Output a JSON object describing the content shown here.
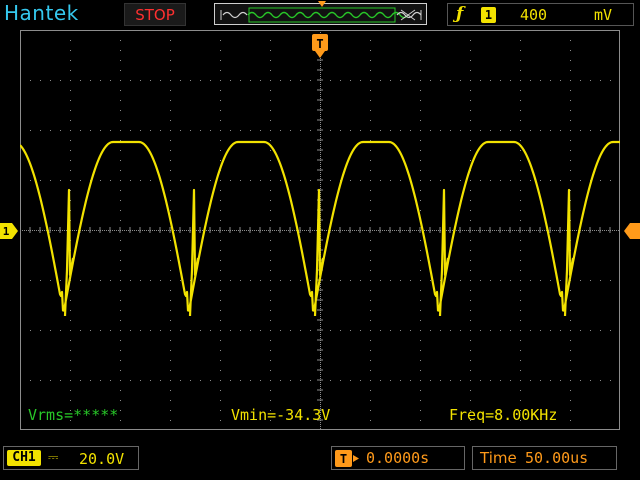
{
  "header": {
    "brand": "Hantek",
    "run_state": "STOP",
    "trigger": {
      "edge_symbol": "ƒ",
      "channel": "1",
      "level_value": "400",
      "level_unit": "mV"
    },
    "buffer_marker_label": "T"
  },
  "markers": {
    "trigger_position_label": "T",
    "channel1_ground_label": "1"
  },
  "measurements": {
    "vrms": "Vrms=*****",
    "vmin": "Vmin=-34.3V",
    "freq": "Freq=8.00KHz"
  },
  "footer": {
    "channel_label": "CH1",
    "coupling_symbol": "⎓",
    "volts_per_div": "20.0V",
    "hpos_icon_label": "T",
    "horizontal_position": "0.0000s",
    "timebase_label": "Time",
    "timebase_value": "50.00us"
  },
  "colors": {
    "trace": "#f2e200",
    "brand": "#35c8ee",
    "stop": "#ff3030",
    "accent_orange": "#ff9a1a",
    "vrms": "#28c828",
    "grid": "#8c8c8c"
  }
}
